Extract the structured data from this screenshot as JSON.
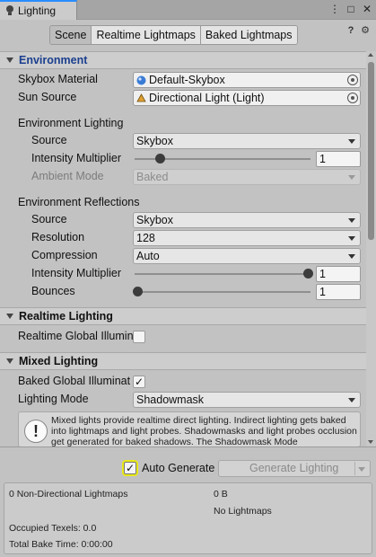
{
  "window": {
    "tab_title": "Lighting",
    "controls": [
      "⋮",
      "□",
      "✕"
    ]
  },
  "toolbar": {
    "tabs": [
      "Scene",
      "Realtime Lightmaps",
      "Baked Lightmaps"
    ],
    "active_tab": "Scene",
    "help_icon": "?",
    "settings_icon": "⚙"
  },
  "environment": {
    "header": "Environment",
    "skybox_material": {
      "label": "Skybox Material",
      "value": "Default-Skybox"
    },
    "sun_source": {
      "label": "Sun Source",
      "value": "Directional Light (Light)"
    },
    "lighting_group": "Environment Lighting",
    "source": {
      "label": "Source",
      "value": "Skybox"
    },
    "intensity": {
      "label": "Intensity Multiplier",
      "value": "1",
      "fraction": 0.0
    },
    "ambient_mode": {
      "label": "Ambient Mode",
      "value": "Baked"
    },
    "reflections_group": "Environment Reflections",
    "refl_source": {
      "label": "Source",
      "value": "Skybox"
    },
    "resolution": {
      "label": "Resolution",
      "value": "128"
    },
    "compression": {
      "label": "Compression",
      "value": "Auto"
    },
    "refl_intensity": {
      "label": "Intensity Multiplier",
      "value": "1",
      "fraction": 1.0
    },
    "bounces": {
      "label": "Bounces",
      "value": "1",
      "fraction": 0.0
    }
  },
  "realtime": {
    "header": "Realtime Lighting",
    "gi_label": "Realtime Global Illumin",
    "gi_checked": false
  },
  "mixed": {
    "header": "Mixed Lighting",
    "baked_gi_label": "Baked Global Illuminat",
    "baked_gi_checked": "✓",
    "mode_label": "Lighting Mode",
    "mode_value": "Shadowmask",
    "help_text": "Mixed lights provide realtime direct lighting. Indirect lighting gets baked into lightmaps and light probes. Shadowmasks and light probes occlusion get generated for baked shadows. The Shadowmask Mode"
  },
  "bottom": {
    "auto_generate_label": "Auto Generate",
    "auto_generate_checked": "✓",
    "generate_button": "Generate Lighting",
    "stats": {
      "nondirectional": "0 Non-Directional Lightmaps",
      "size": "0 B",
      "no_lightmaps": "No Lightmaps",
      "occupied": "Occupied Texels: 0.0",
      "bake_time": "Total Bake Time: 0:00:00"
    }
  },
  "colors": {
    "accent_tab": "#2a8cff",
    "section_env": "#1b3f8f",
    "highlight": "#e8e81a"
  }
}
